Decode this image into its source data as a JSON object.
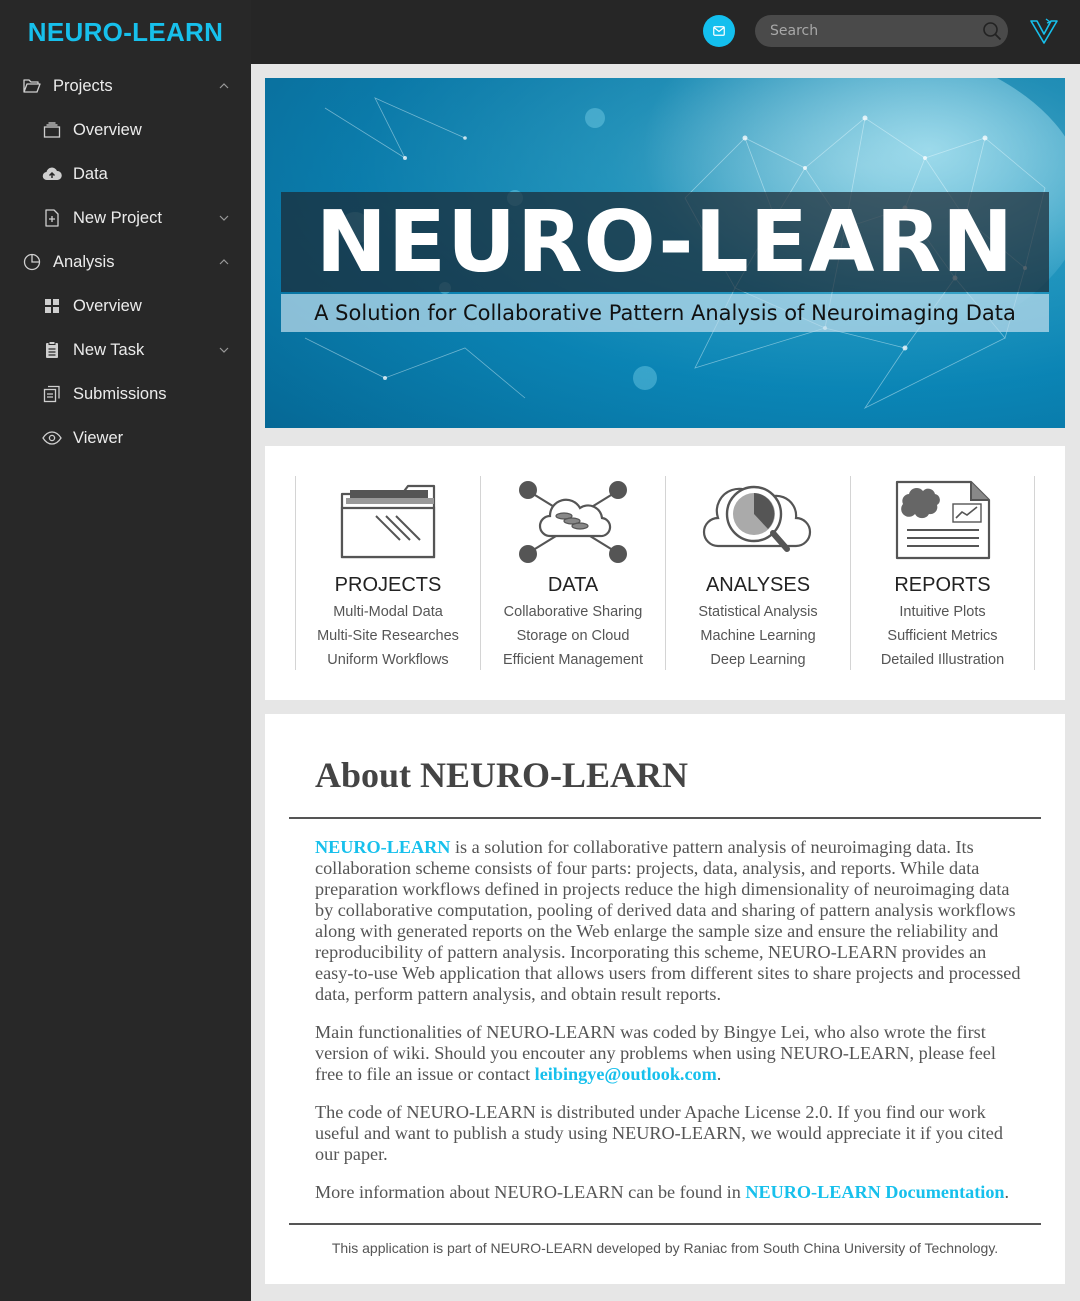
{
  "sidebar": {
    "brand": "NEURO-LEARN",
    "projects": {
      "label": "Projects",
      "items": [
        {
          "label": "Overview"
        },
        {
          "label": "Data"
        },
        {
          "label": "New Project"
        }
      ]
    },
    "analysis": {
      "label": "Analysis",
      "items": [
        {
          "label": "Overview"
        },
        {
          "label": "New Task"
        },
        {
          "label": "Submissions"
        },
        {
          "label": "Viewer"
        }
      ]
    }
  },
  "header": {
    "search_placeholder": "Search",
    "accent": "#17c0ec"
  },
  "banner": {
    "title": "NEURO-LEARN",
    "subtitle": "A Solution for Collaborative Pattern Analysis of Neuroimaging Data"
  },
  "features": [
    {
      "title": "PROJECTS",
      "icon": "folder-icon",
      "lines": [
        "Multi-Modal Data",
        "Multi-Site Researches",
        "Uniform Workflows"
      ]
    },
    {
      "title": "DATA",
      "icon": "cloud-network-icon",
      "lines": [
        "Collaborative Sharing",
        "Storage on Cloud",
        "Efficient Management"
      ]
    },
    {
      "title": "ANALYSES",
      "icon": "cloud-search-chart-icon",
      "lines": [
        "Statistical Analysis",
        "Machine Learning",
        "Deep Learning"
      ]
    },
    {
      "title": "REPORTS",
      "icon": "report-document-icon",
      "lines": [
        "Intuitive Plots",
        "Sufficient Metrics",
        "Detailed Illustration"
      ]
    }
  ],
  "about": {
    "title": "About NEURO-LEARN",
    "p1_link": "NEURO-LEARN",
    "p1_text": " is a solution for collaborative pattern analysis of neuroimaging data. Its collaboration scheme consists of four parts: projects, data, analysis, and reports. While data preparation workflows defined in projects reduce the high dimensionality of neuroimaging data by collaborative computation, pooling of derived data and sharing of pattern analysis workflows along with generated reports on the Web enlarge the sample size and ensure the reliability and reproducibility of pattern analysis. Incorporating this scheme, NEURO-LEARN provides an easy-to-use Web application that allows users from different sites to share projects and processed data, perform pattern analysis, and obtain result reports.",
    "p2_text": "Main functionalities of NEURO-LEARN was coded by Bingye Lei, who also wrote the first version of wiki. Should you encouter any problems when using NEURO-LEARN, please feel free to file an issue or contact ",
    "p2_link": "leibingye@outlook.com",
    "p2_end": ".",
    "p3_text": "The code of NEURO-LEARN is distributed under Apache License 2.0. If you find our work useful and want to publish a study using NEURO-LEARN, we would appreciate it if you cited our paper.",
    "p4_text": "More information about NEURO-LEARN can be found in ",
    "p4_link": "NEURO-LEARN Documentation",
    "p4_end": ".",
    "footer": "This application is part of NEURO-LEARN developed by Raniac from South China University of Technology."
  }
}
